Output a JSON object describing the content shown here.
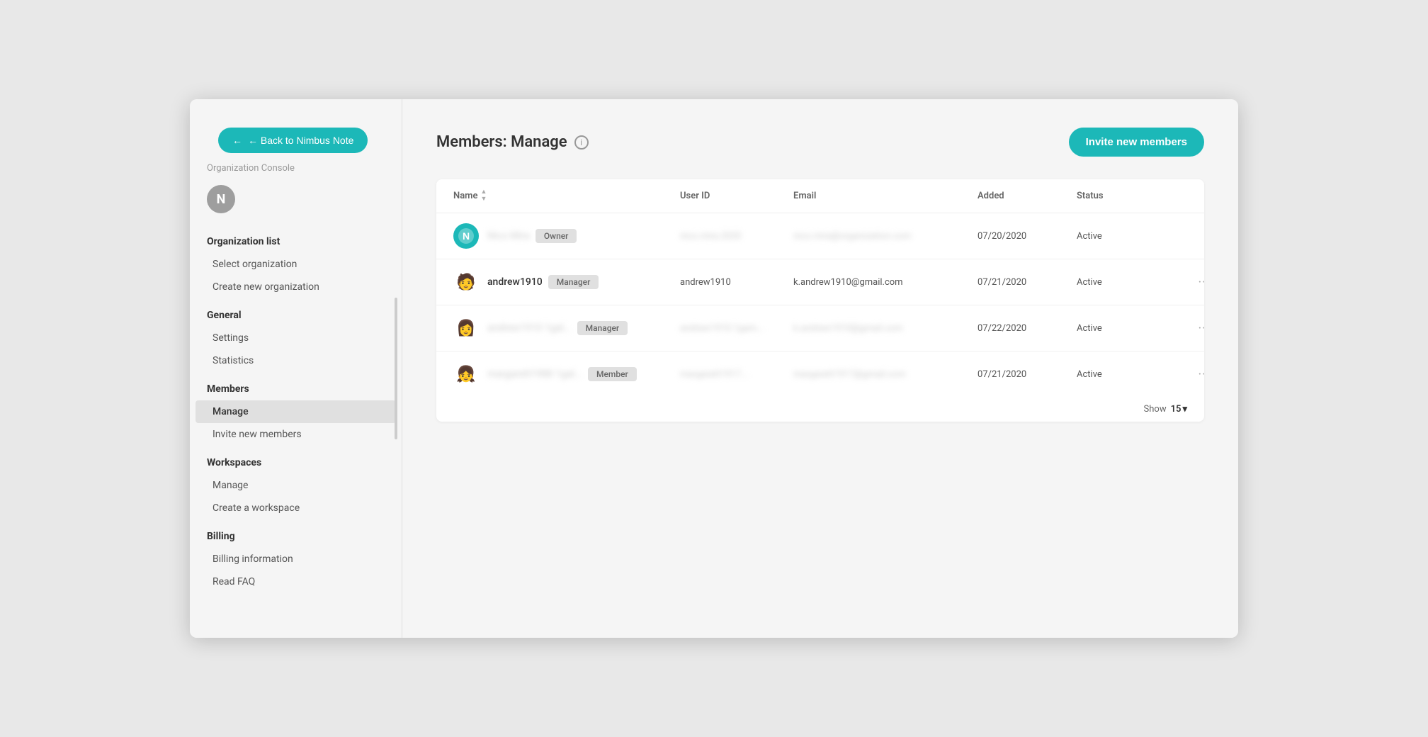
{
  "back_button": {
    "label": "← Back to Nimbus Note"
  },
  "sidebar": {
    "org_console_label": "Organization Console",
    "org_avatar_letter": "N",
    "sections": [
      {
        "title": "Organization list",
        "id": "org-list",
        "items": [
          {
            "label": "Select organization",
            "id": "select-org",
            "active": false
          },
          {
            "label": "Create new organization",
            "id": "create-org",
            "active": false
          }
        ]
      },
      {
        "title": "General",
        "id": "general",
        "items": [
          {
            "label": "Settings",
            "id": "settings",
            "active": false
          },
          {
            "label": "Statistics",
            "id": "statistics",
            "active": false
          }
        ]
      },
      {
        "title": "Members",
        "id": "members",
        "items": [
          {
            "label": "Manage",
            "id": "members-manage",
            "active": true
          },
          {
            "label": "Invite new members",
            "id": "members-invite",
            "active": false
          }
        ]
      },
      {
        "title": "Workspaces",
        "id": "workspaces",
        "items": [
          {
            "label": "Manage",
            "id": "workspaces-manage",
            "active": false
          },
          {
            "label": "Create a workspace",
            "id": "create-workspace",
            "active": false
          }
        ]
      },
      {
        "title": "Billing",
        "id": "billing",
        "items": [
          {
            "label": "Billing information",
            "id": "billing-info",
            "active": false
          },
          {
            "label": "Read FAQ",
            "id": "read-faq",
            "active": false
          }
        ]
      }
    ]
  },
  "page": {
    "title": "Members: Manage",
    "invite_button_label": "Invite new members"
  },
  "table": {
    "columns": [
      "Name",
      "User ID",
      "Email",
      "Added",
      "Status"
    ],
    "rows": [
      {
        "avatar_type": "nimbus",
        "avatar_letter": "N",
        "name": "Nico Mira",
        "name_blurred": true,
        "role": "Owner",
        "user_id": "nico.mira.2020",
        "user_id_blurred": true,
        "email": "nico.mira@organization.com",
        "email_blurred": true,
        "added": "07/20/2020",
        "status": "Active",
        "has_menu": false
      },
      {
        "avatar_type": "emoji",
        "avatar_emoji": "🧑",
        "name": "andrew1910",
        "name_blurred": false,
        "role": "Manager",
        "user_id": "andrew1910",
        "user_id_blurred": false,
        "email": "k.andrew1910@gmail.com",
        "email_blurred": false,
        "added": "07/21/2020",
        "status": "Active",
        "has_menu": true
      },
      {
        "avatar_type": "emoji",
        "avatar_emoji": "👩",
        "name": "andrew1910 1gal...",
        "name_blurred": true,
        "role": "Manager",
        "user_id": "andrew1910.1gam...",
        "user_id_blurred": true,
        "email": "k.andrew1910@gmail.com",
        "email_blurred": true,
        "added": "07/22/2020",
        "status": "Active",
        "has_menu": true
      },
      {
        "avatar_type": "emoji",
        "avatar_emoji": "👧",
        "name": "margarett1988 1gal...",
        "name_blurred": true,
        "role": "Member",
        "user_id": "margarett1917...",
        "user_id_blurred": true,
        "email": "margarett1917@gmail.com",
        "email_blurred": true,
        "added": "07/21/2020",
        "status": "Active",
        "has_menu": true
      }
    ]
  },
  "show_bar": {
    "label": "Show",
    "value": "15"
  }
}
